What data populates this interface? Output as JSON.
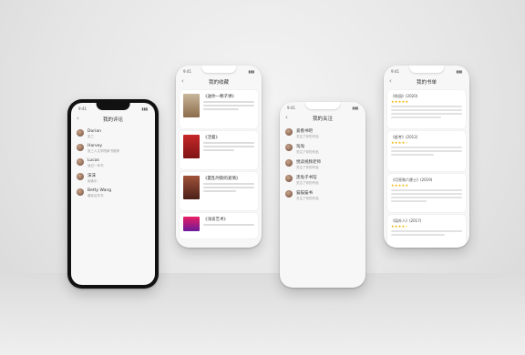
{
  "phone1": {
    "title": "我的评论",
    "items": [
      {
        "name": "Dorian",
        "sub": "张三"
      },
      {
        "name": "Harvey",
        "sub": "张三人文学院新书推荐"
      },
      {
        "name": "Lucas",
        "sub": "读过一本书"
      },
      {
        "name": "沫沫",
        "sub": "阅读中"
      },
      {
        "name": "Betty Wang",
        "sub": "喜欢这本书"
      }
    ]
  },
  "phone2": {
    "title": "我的收藏",
    "books": [
      {
        "title": "《送你一颗子弹》",
        "color": "#8b6b4a"
      },
      {
        "title": "《活着》",
        "color": "#b3262a"
      },
      {
        "title": "《霍乱时期的爱情》",
        "color": "#7a3a2a"
      },
      {
        "title": "《浅谈艺术》",
        "color": "#c2185b"
      }
    ]
  },
  "phone3": {
    "title": "我的关注",
    "items": [
      {
        "name": "爱看书吧",
        "sub": "关注了你的作品"
      },
      {
        "name": "淘淘",
        "sub": "关注了你的作品"
      },
      {
        "name": "悦读视频老师",
        "sub": "关注了你的作品"
      },
      {
        "name": "黑兔子书馆",
        "sub": "关注了你的作品"
      },
      {
        "name": "猫猫猫书",
        "sub": "关注了你的作品"
      }
    ]
  },
  "phone4": {
    "title": "我的书单",
    "reviews": [
      {
        "title": "《秋园》(2020)",
        "stars": "★★★★★"
      },
      {
        "title": "《赶考》(2012)",
        "stars": "★★★★☆"
      },
      {
        "title": "《月亮和六便士》(2019)",
        "stars": "★★★★★"
      },
      {
        "title": "《局外人》(2017)",
        "stars": "★★★★☆"
      }
    ]
  }
}
